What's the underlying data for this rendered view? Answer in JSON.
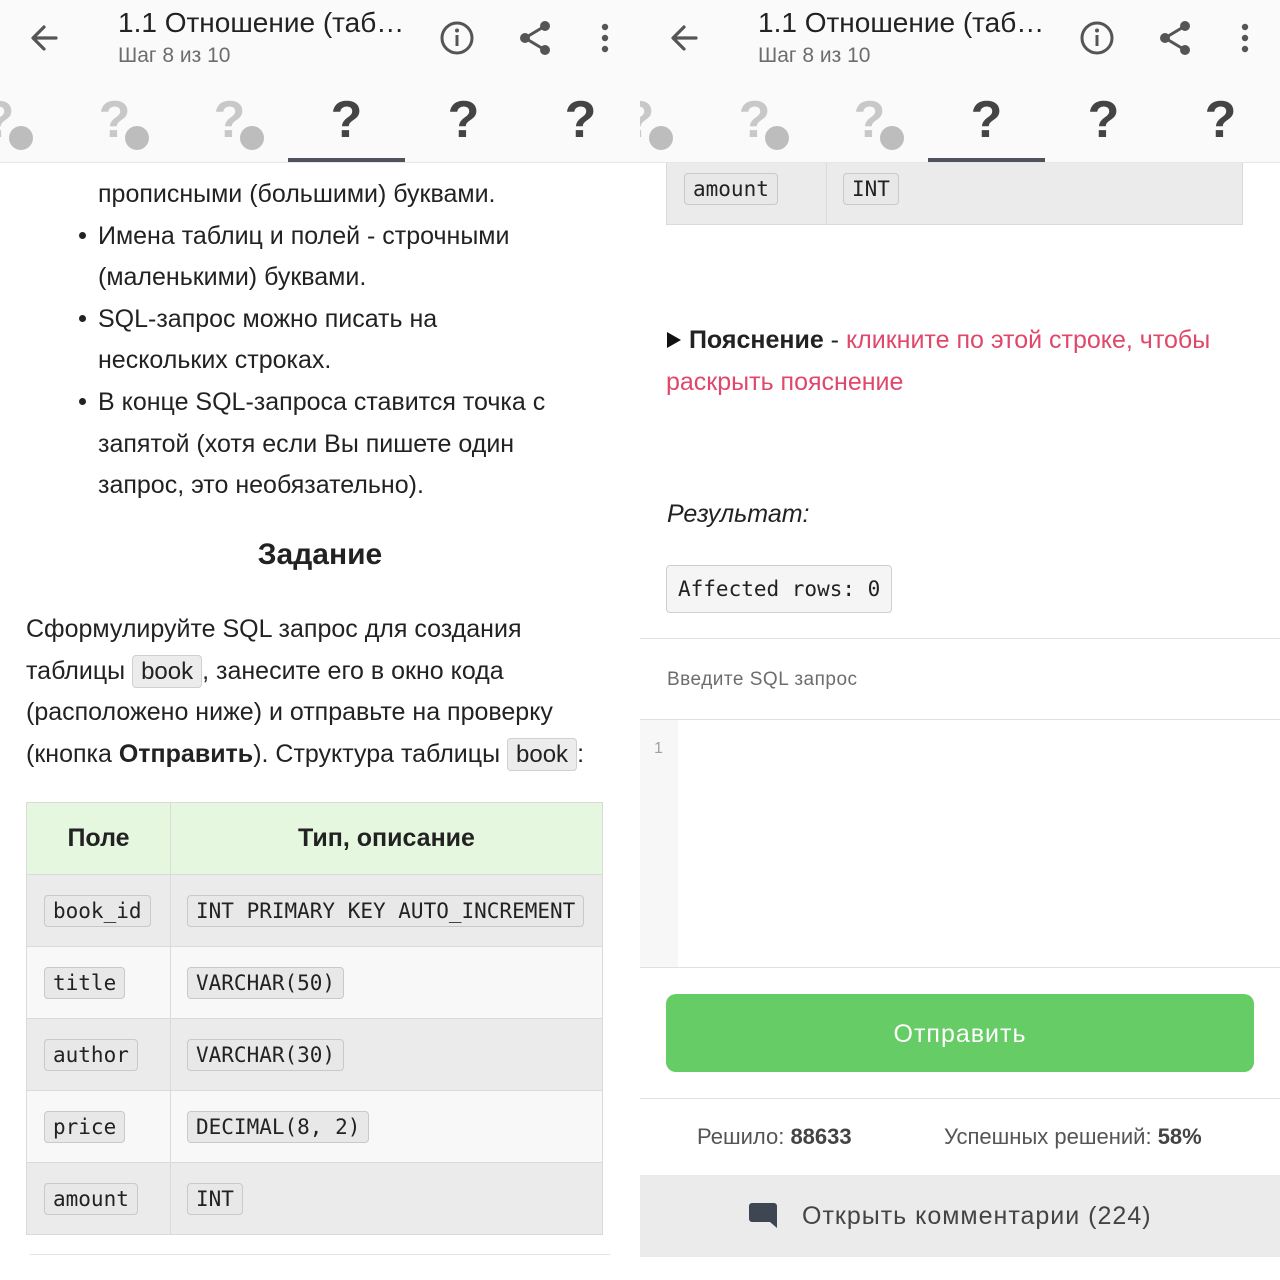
{
  "appbar": {
    "title_left": "1.1 Отношение (таб…",
    "title_right": "1.1 Отношение (таб…",
    "subtitle": "Шаг 8 из 10"
  },
  "steps": [
    {
      "label": "?",
      "state": "done"
    },
    {
      "label": "?",
      "state": "done"
    },
    {
      "label": "?",
      "state": "done"
    },
    {
      "label": "?",
      "state": "active"
    },
    {
      "label": "?",
      "state": "todo"
    },
    {
      "label": "?",
      "state": "todo"
    }
  ],
  "left": {
    "list_lines": [
      "прописными (большими) буквами.",
      "Имена таблиц и полей - строчными",
      "(маленькими) буквами.",
      "SQL-запрос можно писать на",
      "нескольких строках.",
      "В конце SQL-запроса ставится точка с",
      "запятой (хотя если Вы пишете один",
      "запрос, это необязательно)."
    ],
    "task_heading": "Задание",
    "para": {
      "l1": "Сформулируйте SQL запрос для создания",
      "l2_a": "таблицы",
      "l2_code": "book",
      "l2_b": ", занесите  его в окно кода",
      "l3": "(расположено ниже)  и отправьте на проверку",
      "l4_a": "(кнопка ",
      "l4_bold": "Отправить",
      "l4_b": "). Структура таблицы",
      "l4_code": "book",
      "l4_c": ":"
    },
    "table": {
      "headers": [
        "Поле",
        "Тип, описание"
      ],
      "rows": [
        {
          "field": "book_id",
          "type": "INT PRIMARY KEY AUTO_INCREMENT"
        },
        {
          "field": "title",
          "type": "VARCHAR(50)"
        },
        {
          "field": "author",
          "type": "VARCHAR(30)"
        },
        {
          "field": "price",
          "type": "DECIMAL(8, 2)"
        },
        {
          "field": "amount",
          "type": "INT"
        }
      ]
    }
  },
  "right": {
    "table_tail_row": {
      "field": "amount",
      "type": "INT"
    },
    "explanation": {
      "label": "Пояснение",
      "sep": " - ",
      "link_l1": "кликните по этой строке, чтобы",
      "link_l2": "раскрыть пояснение"
    },
    "result_label": "Результат:",
    "result_value": "Affected rows: 0",
    "editor_label": "Введите SQL запрос",
    "editor_line_number": "1",
    "submit_label": "Отправить",
    "stats": {
      "solved_label": "Решило: ",
      "solved_value": "88633",
      "success_label": "Успешных решений: ",
      "success_value": "58%"
    },
    "comments_label": "Открыть комментарии (224)"
  },
  "colors": {
    "accent_green": "#66cc66",
    "link_red": "#e0476a",
    "table_header_bg": "#e6f7e0"
  }
}
